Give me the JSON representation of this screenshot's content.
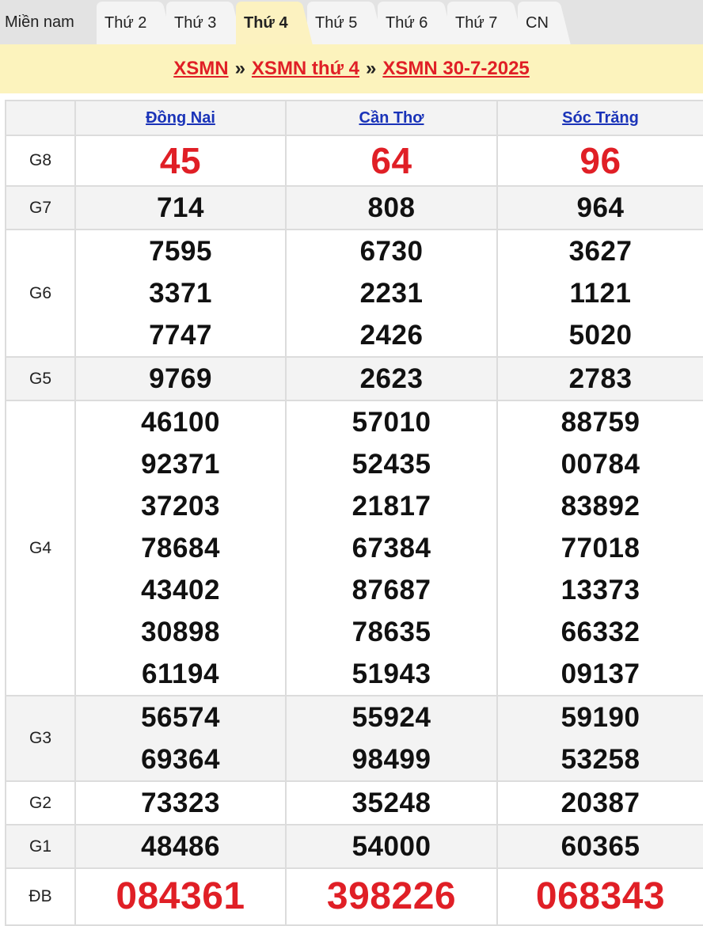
{
  "tabs": {
    "region": "Miền nam",
    "days": [
      "Thứ 2",
      "Thứ 3",
      "Thứ 4",
      "Thứ 5",
      "Thứ 6",
      "Thứ 7",
      "CN"
    ],
    "active": "Thứ 4"
  },
  "breadcrumb": {
    "home": "XSMN",
    "day": "XSMN thứ 4",
    "date": "XSMN 30-7-2025",
    "separator": "»"
  },
  "provinces": [
    "Đồng Nai",
    "Cần Thơ",
    "Sóc Trăng"
  ],
  "prizes": [
    {
      "label": "G8",
      "results": [
        [
          "45"
        ],
        [
          "64"
        ],
        [
          "96"
        ]
      ]
    },
    {
      "label": "G7",
      "results": [
        [
          "714"
        ],
        [
          "808"
        ],
        [
          "964"
        ]
      ]
    },
    {
      "label": "G6",
      "results": [
        [
          "7595",
          "3371",
          "7747"
        ],
        [
          "6730",
          "2231",
          "2426"
        ],
        [
          "3627",
          "1121",
          "5020"
        ]
      ]
    },
    {
      "label": "G5",
      "results": [
        [
          "9769"
        ],
        [
          "2623"
        ],
        [
          "2783"
        ]
      ]
    },
    {
      "label": "G4",
      "results": [
        [
          "46100",
          "92371",
          "37203",
          "78684",
          "43402",
          "30898",
          "61194"
        ],
        [
          "57010",
          "52435",
          "21817",
          "67384",
          "87687",
          "78635",
          "51943"
        ],
        [
          "88759",
          "00784",
          "83892",
          "77018",
          "13373",
          "66332",
          "09137"
        ]
      ]
    },
    {
      "label": "G3",
      "results": [
        [
          "56574",
          "69364"
        ],
        [
          "55924",
          "98499"
        ],
        [
          "59190",
          "53258"
        ]
      ]
    },
    {
      "label": "G2",
      "results": [
        [
          "73323"
        ],
        [
          "35248"
        ],
        [
          "20387"
        ]
      ]
    },
    {
      "label": "G1",
      "results": [
        [
          "48486"
        ],
        [
          "54000"
        ],
        [
          "60365"
        ]
      ]
    },
    {
      "label": "ĐB",
      "results": [
        [
          "084361"
        ],
        [
          "398226"
        ],
        [
          "068343"
        ]
      ]
    }
  ],
  "colors": {
    "accent_red": "#e01f26",
    "link_blue": "#1a33b8",
    "banner_yellow": "#fcf3bd"
  }
}
